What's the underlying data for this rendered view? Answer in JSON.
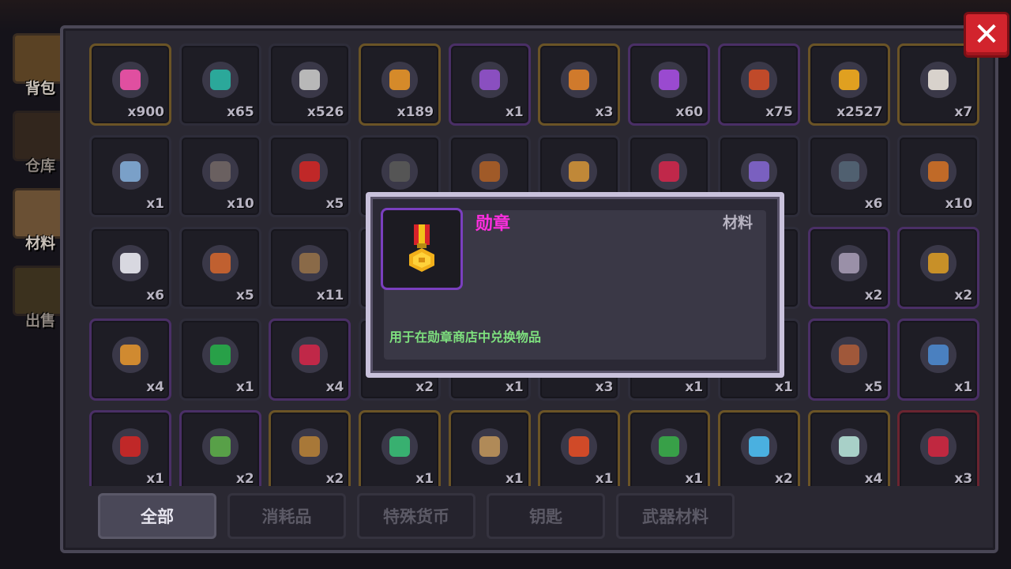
{
  "side_tabs": [
    {
      "label": "背包",
      "icon": "backpack-icon"
    },
    {
      "label": "仓库",
      "icon": "warehouse-icon"
    },
    {
      "label": "材料",
      "icon": "materials-icon"
    },
    {
      "label": "出售",
      "icon": "sell-icon"
    }
  ],
  "close_button": {
    "label": "✕"
  },
  "items": [
    {
      "count": "x900",
      "icon": "pink-gem-icon",
      "color": "#e04fa0",
      "rim": "gold"
    },
    {
      "count": "x65",
      "icon": "teal-coin-icon",
      "color": "#2ba89a",
      "rim": "plain"
    },
    {
      "count": "x526",
      "icon": "silver-ore-icon",
      "color": "#b8b8b8",
      "rim": "plain"
    },
    {
      "count": "x189",
      "icon": "gold-dust-icon",
      "color": "#d58a2a",
      "rim": "gold"
    },
    {
      "count": "x1",
      "icon": "purple-key-icon",
      "color": "#8a4fc0",
      "rim": "purple"
    },
    {
      "count": "x3",
      "icon": "orange-key-icon",
      "color": "#d07a2c",
      "rim": "gold"
    },
    {
      "count": "x60",
      "icon": "purple-token-icon",
      "color": "#9a4ad0",
      "rim": "purple"
    },
    {
      "count": "x75",
      "icon": "red-stick-icon",
      "color": "#c04a2a",
      "rim": "purple"
    },
    {
      "count": "x2527",
      "icon": "medal-icon",
      "color": "#e0a020",
      "rim": "gold"
    },
    {
      "count": "x7",
      "icon": "bell-jar-icon",
      "color": "#d8d2cc",
      "rim": "gold"
    },
    {
      "count": "x1",
      "icon": "spear-icon",
      "color": "#7aa0c8",
      "rim": "plain"
    },
    {
      "count": "x10",
      "icon": "pistol-part-icon",
      "color": "#6a6060",
      "rim": "plain"
    },
    {
      "count": "x5",
      "icon": "red-blade-icon",
      "color": "#c02828",
      "rim": "plain"
    },
    {
      "count": "",
      "icon": "hidden-icon",
      "color": "#555",
      "rim": "plain"
    },
    {
      "count": "",
      "icon": "hidden-icon",
      "color": "#a05a28",
      "rim": "plain"
    },
    {
      "count": "",
      "icon": "hidden-icon",
      "color": "#c08838",
      "rim": "plain"
    },
    {
      "count": "",
      "icon": "hidden-icon",
      "color": "#c0284a",
      "rim": "plain"
    },
    {
      "count": "",
      "icon": "hidden-icon",
      "color": "#7a60c0",
      "rim": "plain"
    },
    {
      "count": "x6",
      "icon": "cable-icon",
      "color": "#506070",
      "rim": "plain"
    },
    {
      "count": "x10",
      "icon": "leather-icon",
      "color": "#c06a28",
      "rim": "plain"
    },
    {
      "count": "x6",
      "icon": "slime-icon",
      "color": "#d8d8e0",
      "rim": "plain"
    },
    {
      "count": "x5",
      "icon": "lantern-icon",
      "color": "#c06030",
      "rim": "plain"
    },
    {
      "count": "x11",
      "icon": "scroll-icon",
      "color": "#8a6a48",
      "rim": "plain"
    },
    {
      "count": "",
      "icon": "hidden-icon",
      "color": "#555",
      "rim": "plain"
    },
    {
      "count": "",
      "icon": "hidden-icon",
      "color": "#555",
      "rim": "plain"
    },
    {
      "count": "",
      "icon": "hidden-icon",
      "color": "#555",
      "rim": "plain"
    },
    {
      "count": "",
      "icon": "hidden-icon",
      "color": "#555",
      "rim": "plain"
    },
    {
      "count": "",
      "icon": "hidden-icon",
      "color": "#555",
      "rim": "plain"
    },
    {
      "count": "x2",
      "icon": "gear-ring-icon",
      "color": "#9a90a8",
      "rim": "purple"
    },
    {
      "count": "x2",
      "icon": "golden-claw-icon",
      "color": "#c89028",
      "rim": "purple"
    },
    {
      "count": "x4",
      "icon": "ring-icon",
      "color": "#d08a30",
      "rim": "purple"
    },
    {
      "count": "x1",
      "icon": "green-eye-icon",
      "color": "#28a048",
      "rim": "plain"
    },
    {
      "count": "x4",
      "icon": "whip-icon",
      "color": "#c02848",
      "rim": "purple"
    },
    {
      "count": "x2",
      "icon": "hidden-icon",
      "color": "#555",
      "rim": "plain"
    },
    {
      "count": "x1",
      "icon": "hidden-icon",
      "color": "#555",
      "rim": "plain"
    },
    {
      "count": "x3",
      "icon": "hidden-icon",
      "color": "#555",
      "rim": "plain"
    },
    {
      "count": "x1",
      "icon": "hidden-icon",
      "color": "#555",
      "rim": "plain"
    },
    {
      "count": "x1",
      "icon": "hidden-icon",
      "color": "#555",
      "rim": "plain"
    },
    {
      "count": "x5",
      "icon": "crossbow-part-icon",
      "color": "#a0583a",
      "rim": "purple"
    },
    {
      "count": "x1",
      "icon": "blue-blade-icon",
      "color": "#4a80c0",
      "rim": "purple"
    },
    {
      "count": "x1",
      "icon": "red-potion-icon",
      "color": "#c02828",
      "rim": "purple"
    },
    {
      "count": "x2",
      "icon": "green-plant-icon",
      "color": "#58a048",
      "rim": "purple"
    },
    {
      "count": "x2",
      "icon": "crossbow-icon",
      "color": "#a87838",
      "rim": "gold"
    },
    {
      "count": "x1",
      "icon": "green-gear-icon",
      "color": "#38b070",
      "rim": "gold"
    },
    {
      "count": "x1",
      "icon": "pickaxe-icon",
      "color": "#b08a58",
      "rim": "gold"
    },
    {
      "count": "x1",
      "icon": "flower-icon",
      "color": "#d04a28",
      "rim": "gold"
    },
    {
      "count": "x1",
      "icon": "green-boot-icon",
      "color": "#38a048",
      "rim": "gold"
    },
    {
      "count": "x2",
      "icon": "blue-crystal-icon",
      "color": "#4ab0e0",
      "rim": "gold"
    },
    {
      "count": "x4",
      "icon": "skull-jaw-icon",
      "color": "#a8d0c8",
      "rim": "gold"
    },
    {
      "count": "x3",
      "icon": "red-rune-icon",
      "color": "#c02840",
      "rim": "red"
    }
  ],
  "category_tabs": [
    {
      "label": "全部",
      "active": true
    },
    {
      "label": "消耗品",
      "active": false
    },
    {
      "label": "特殊货币",
      "active": false
    },
    {
      "label": "钥匙",
      "active": false
    },
    {
      "label": "武器材料",
      "active": false
    }
  ],
  "tooltip": {
    "title": "勋章",
    "type": "材料",
    "description": "用于在勋章商店中兑换物品",
    "icon": "medal-icon",
    "title_color": "#ff2ee0",
    "desc_color": "#7ee07e"
  }
}
